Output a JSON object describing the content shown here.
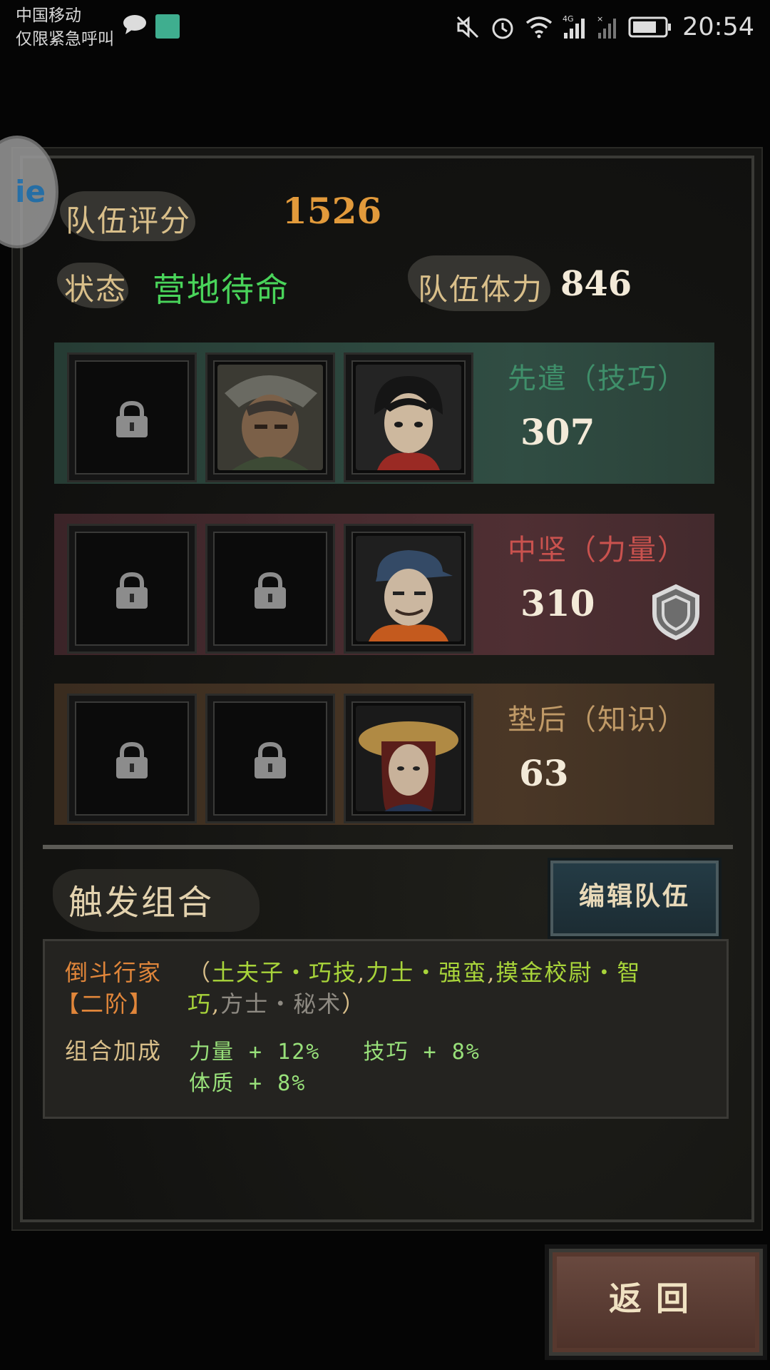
{
  "status_bar": {
    "carrier": "中国移动",
    "emergency": "仅限紧急呼叫",
    "time": "20:54",
    "icons": [
      "chat-icon",
      "app-icon",
      "mute-icon",
      "alarm-icon",
      "wifi-icon",
      "signal-4g-icon",
      "signal-icon",
      "battery-icon"
    ]
  },
  "team": {
    "score_label": "队伍评分",
    "score_value": "1526",
    "status_label": "状态",
    "status_value": "营地待命",
    "stamina_label": "队伍体力",
    "stamina_value": "846"
  },
  "rows": [
    {
      "title": "先遣（技巧）",
      "score": "307",
      "color": "#3f8f6a"
    },
    {
      "title": "中坚（力量）",
      "score": "310",
      "color": "#c9524e"
    },
    {
      "title": "垫后（知识）",
      "score": "63",
      "color": "#c09a67"
    }
  ],
  "combo": {
    "title": "触发组合",
    "edit_button": "编辑队伍",
    "name": "倒斗行家",
    "tier": "【二阶】",
    "members_open": "（",
    "member1": "土夫子・巧技",
    "sep1": ",",
    "member2": "力士・强蛮",
    "sep2": ",",
    "member3a": "摸金校尉・智",
    "member3b": "巧",
    "sep3": ",",
    "member4": "方士・秘术",
    "members_close": "）",
    "bonus_label": "组合加成",
    "bonus_line1": "力量 + 12%   技巧 + 8%",
    "bonus_line2": "体质 + 8%"
  },
  "back_button": "返回"
}
